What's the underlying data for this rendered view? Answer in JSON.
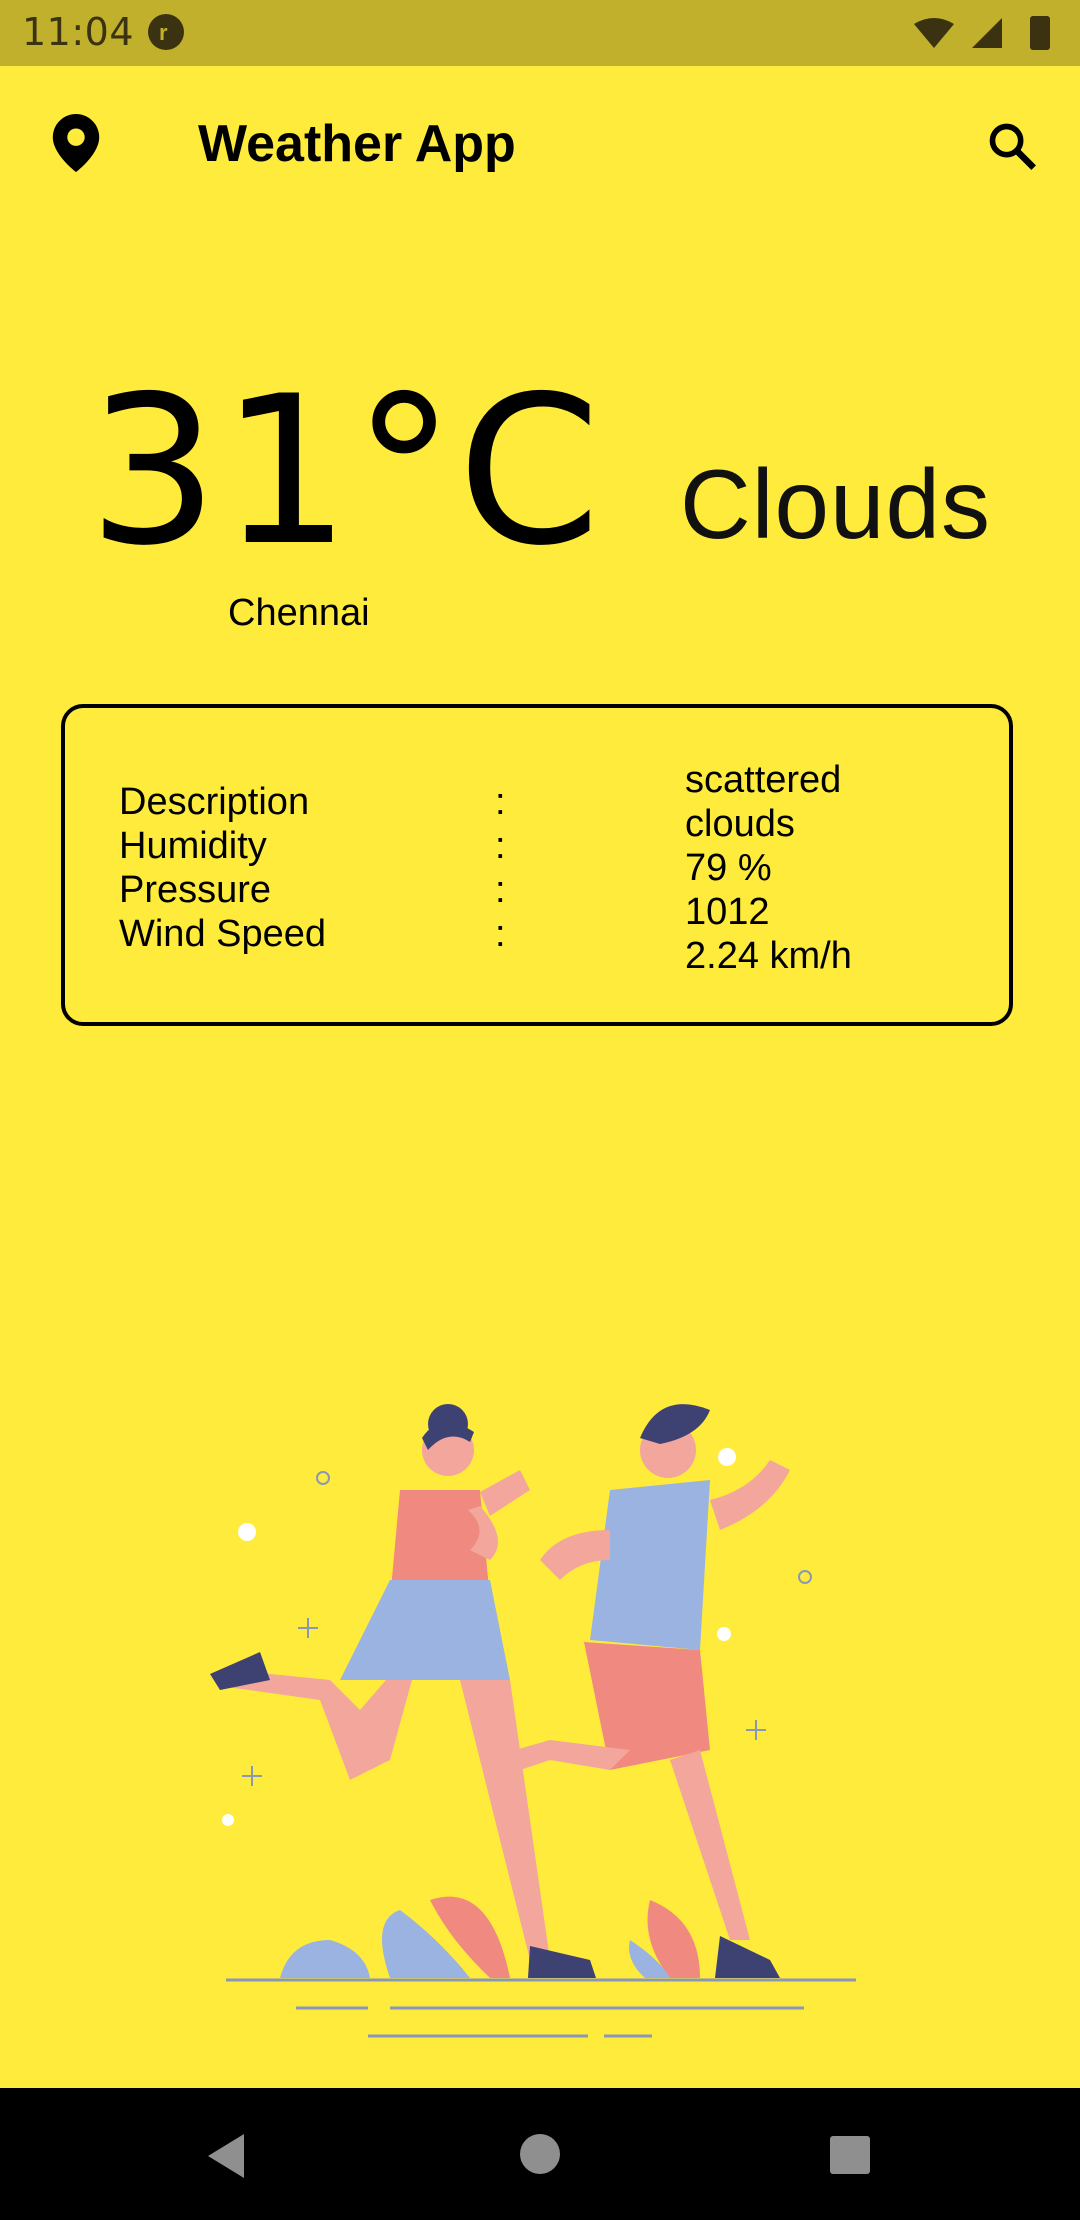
{
  "status_bar": {
    "time": "11:04"
  },
  "app_bar": {
    "title": "Weather App",
    "location_icon": "location-pin-icon",
    "search_icon": "search-icon"
  },
  "weather": {
    "temperature": "31°C",
    "city": "Chennai",
    "condition": "Clouds"
  },
  "details": {
    "labels": [
      "Description",
      "Humidity",
      "Pressure",
      "Wind Speed"
    ],
    "separator": ":",
    "values": [
      "scattered clouds",
      "79 %",
      "1012",
      "2.24 km/h"
    ]
  },
  "nav": {
    "back_icon": "back-triangle-icon",
    "home_icon": "home-circle-icon",
    "recents_icon": "recents-square-icon"
  },
  "colors": {
    "background": "#FFEB3B",
    "status_bar": "#C0B02B",
    "nav_bar": "#000000"
  }
}
